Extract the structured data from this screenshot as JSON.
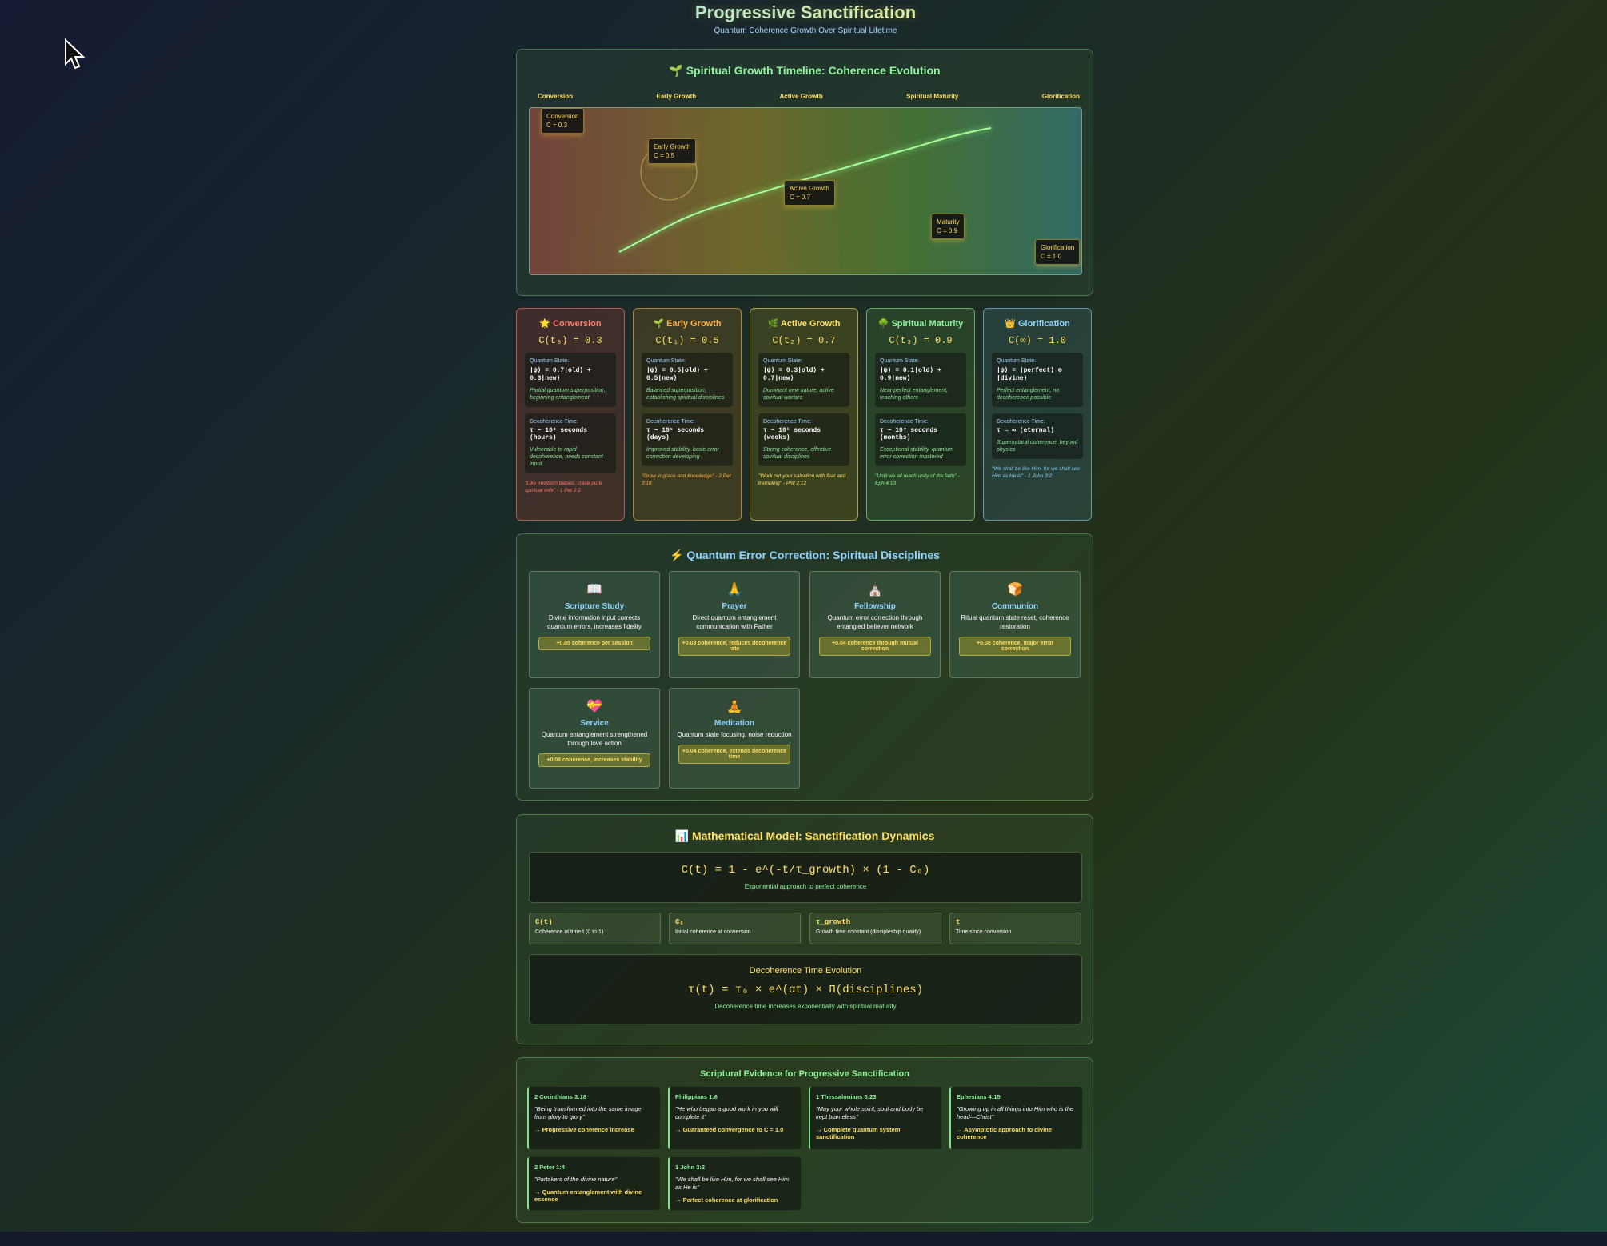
{
  "header": {
    "title": "Progressive Sanctification",
    "subtitle": "Quantum Coherence Growth Over Spiritual Lifetime"
  },
  "timeline": {
    "title": "🌱 Spiritual Growth Timeline: Coherence Evolution",
    "phase_labels": [
      "Conversion",
      "Early Growth",
      "Active Growth",
      "Spiritual Maturity",
      "Glorification"
    ],
    "markers": [
      {
        "name": "Conversion",
        "value": "C = 0.3"
      },
      {
        "name": "Early Growth",
        "value": "C = 0.5"
      },
      {
        "name": "Active Growth",
        "value": "C = 0.7"
      },
      {
        "name": "Maturity",
        "value": "C = 0.9"
      },
      {
        "name": "Glorification",
        "value": "C = 1.0"
      }
    ]
  },
  "stages": [
    {
      "name": "🌟 Conversion",
      "equation": "C(t₀) = 0.3",
      "state_label": "Quantum State:",
      "state": "|ψ⟩ = 0.7|old⟩ + 0.3|new⟩",
      "state_desc": "Partial quantum superposition, beginning entanglement",
      "deco_label": "Decoherence Time:",
      "deco": "τ ~ 10⁴ seconds (hours)",
      "deco_desc": "Vulnerable to rapid decoherence, needs constant input",
      "quote": "\"Like newborn babies, crave pure spiritual milk\" - 1 Pet 2:2",
      "color": "#ff7a6b"
    },
    {
      "name": "🌱 Early Growth",
      "equation": "C(t₁) = 0.5",
      "state_label": "Quantum State:",
      "state": "|ψ⟩ = 0.5|old⟩ + 0.5|new⟩",
      "state_desc": "Balanced superposition, establishing spiritual disciplines",
      "deco_label": "Decoherence Time:",
      "deco": "τ ~ 10⁵ seconds (days)",
      "deco_desc": "Improved stability, basic error correction developing",
      "quote": "\"Grow in grace and knowledge\" - 2 Pet 3:18",
      "color": "#ffb347"
    },
    {
      "name": "🌿 Active Growth",
      "equation": "C(t₂) = 0.7",
      "state_label": "Quantum State:",
      "state": "|ψ⟩ = 0.3|old⟩ + 0.7|new⟩",
      "state_desc": "Dominant new nature, active spiritual warfare",
      "deco_label": "Decoherence Time:",
      "deco": "τ ~ 10⁶ seconds (weeks)",
      "deco_desc": "Strong coherence, effective spiritual disciplines",
      "quote": "\"Work out your salvation with fear and trembling\" - Phil 2:12",
      "color": "#ffe066"
    },
    {
      "name": "🌳 Spiritual Maturity",
      "equation": "C(t₃) = 0.9",
      "state_label": "Quantum State:",
      "state": "|ψ⟩ = 0.1|old⟩ + 0.9|new⟩",
      "state_desc": "Near-perfect entanglement, teaching others",
      "deco_label": "Decoherence Time:",
      "deco": "τ ~ 10⁷ seconds (months)",
      "deco_desc": "Exceptional stability, quantum error correction mastered",
      "quote": "\"Until we all reach unity of the faith\" - Eph 4:13",
      "color": "#8ff59a"
    },
    {
      "name": "👑 Glorification",
      "equation": "C(∞) = 1.0",
      "state_label": "Quantum State:",
      "state": "|ψ⟩ = |perfect⟩ ⊗ |divine⟩",
      "state_desc": "Perfect entanglement, no decoherence possible",
      "deco_label": "Decoherence Time:",
      "deco": "τ → ∞ (eternal)",
      "deco_desc": "Supernatural coherence, beyond physics",
      "quote": "\"We shall be like Him, for we shall see Him as He is\" - 1 John 3:2",
      "color": "#8fd4ff"
    }
  ],
  "disciplines": {
    "title": "⚡ Quantum Error Correction: Spiritual Disciplines",
    "items": [
      {
        "icon": "📖",
        "name": "Scripture Study",
        "desc": "Divine information input corrects quantum errors, increases fidelity",
        "effect": "+0.05 coherence per session"
      },
      {
        "icon": "🙏",
        "name": "Prayer",
        "desc": "Direct quantum entanglement communication with Father",
        "effect": "+0.03 coherence, reduces decoherence rate"
      },
      {
        "icon": "⛪",
        "name": "Fellowship",
        "desc": "Quantum error correction through entangled believer network",
        "effect": "+0.04 coherence through mutual correction"
      },
      {
        "icon": "🍞",
        "name": "Communion",
        "desc": "Ritual quantum state reset, coherence restoration",
        "effect": "+0.08 coherence, major error correction"
      },
      {
        "icon": "💝",
        "name": "Service",
        "desc": "Quantum entanglement strengthened through love action",
        "effect": "+0.06 coherence, increases stability"
      },
      {
        "icon": "🧘",
        "name": "Meditation",
        "desc": "Quantum state focusing, noise reduction",
        "effect": "+0.04 coherence, extends decoherence time"
      }
    ]
  },
  "math": {
    "title": "📊 Mathematical Model: Sanctification Dynamics",
    "main_eq": "C(t) = 1 - e^(-t/τ_growth) × (1 - C₀)",
    "main_desc": "Exponential approach to perfect coherence",
    "vars": [
      {
        "sym": "C(t)",
        "desc": "Coherence at time t (0 to 1)"
      },
      {
        "sym": "C₀",
        "desc": "Initial coherence at conversion"
      },
      {
        "sym": "τ_growth",
        "desc": "Growth time constant (discipleship quality)"
      },
      {
        "sym": "t",
        "desc": "Time since conversion"
      }
    ],
    "deco_title": "Decoherence Time Evolution",
    "deco_eq": "τ(t) = τ₀ × e^(αt) × Π(disciplines)",
    "deco_desc": "Decoherence time increases exponentially with spiritual maturity"
  },
  "evidence": {
    "title": "Scriptural Evidence for Progressive Sanctification",
    "items": [
      {
        "ref": "2 Corinthians 3:18",
        "text": "\"Being transformed into the same image from glory to glory\"",
        "impl": "→ Progressive coherence increase"
      },
      {
        "ref": "Philippians 1:6",
        "text": "\"He who began a good work in you will complete it\"",
        "impl": "→ Guaranteed convergence to C = 1.0"
      },
      {
        "ref": "1 Thessalonians 5:23",
        "text": "\"May your whole spirit, soul and body be kept blameless\"",
        "impl": "→ Complete quantum system sanctification"
      },
      {
        "ref": "Ephesians 4:15",
        "text": "\"Growing up in all things into Him who is the head—Christ\"",
        "impl": "→ Asymptotic approach to divine coherence"
      },
      {
        "ref": "2 Peter 1:4",
        "text": "\"Partakers of the divine nature\"",
        "impl": "→ Quantum entanglement with divine essence"
      },
      {
        "ref": "1 John 3:2",
        "text": "\"We shall be like Him, for we shall see Him as He is\"",
        "impl": "→ Perfect coherence at glorification"
      }
    ]
  }
}
